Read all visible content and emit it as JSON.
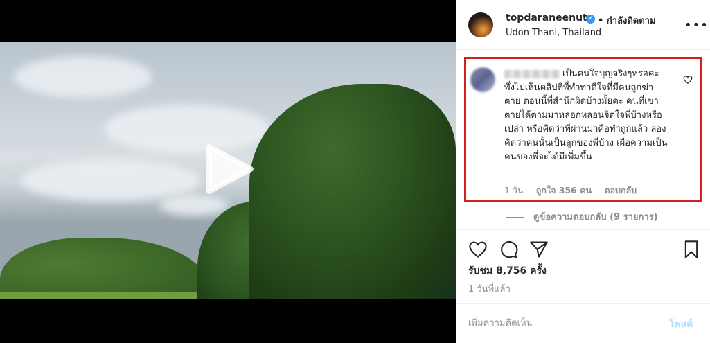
{
  "post": {
    "username": "topdaraneenute",
    "verified_mark": "✔",
    "follow_status": "• กำลังติดตาม",
    "location": "Udon Thani, Thailand",
    "more_icon": "•••"
  },
  "highlighted_comment": {
    "text": "เป็นคนใจบุญจริงๆหรอคะ พึ่งไปเห็นคลิปที่พี่ทำท่าดีใจที่มีคนถูกฆ่าตาย ตอนนี้พี่สำนึกผิดบ้างมั้ยคะ คนที่เขาตายได้ตามมาหลอกหลอนจิตใจพี่บ้างหรือเปล่า หรือคิดว่าที่ผ่านมาคือทำถูกแล้ว ลองคิดว่าคนนั้นเป็นลูกของพี่บ้าง เผื่อความเป็นคนของพี่จะได้มีเพิ่มขึ้น",
    "time": "1 วัน",
    "likes": "ถูกใจ 356 คน",
    "reply_label": "ตอบกลับ",
    "highlight_color": "#d21f1f"
  },
  "view_replies_label": "ดูข้อความตอบกลับ (9 รายการ)",
  "engagement": {
    "views": "รับชม 8,756 ครั้ง",
    "time_ago": "1 วันที่แล้ว"
  },
  "comment_input": {
    "placeholder": "เพิ่มความคิดเห็น",
    "post_label": "โพสต์"
  },
  "icons": {
    "play": "play-icon",
    "like": "heart-icon",
    "comment": "comment-icon",
    "share": "share-icon",
    "save": "bookmark-icon"
  }
}
